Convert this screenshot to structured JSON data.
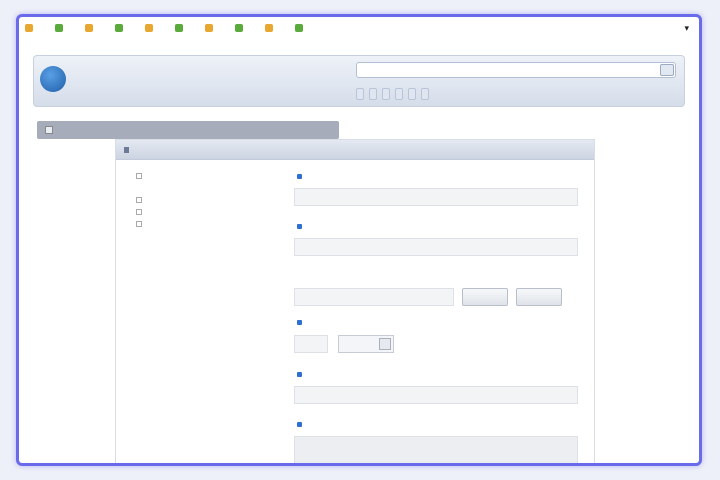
{
  "bookmarks": [
    {
      "label": "",
      "favicon": "orange-favicon-icon"
    },
    {
      "label": "",
      "favicon": "green-favicon-icon"
    },
    {
      "label": "",
      "favicon": "orange-favicon-icon"
    },
    {
      "label": "",
      "favicon": "green-favicon-icon"
    },
    {
      "label": "",
      "favicon": "orange-favicon-icon"
    },
    {
      "label": "",
      "favicon": "green-favicon-icon"
    },
    {
      "label": "",
      "favicon": "orange-favicon-icon"
    },
    {
      "label": "",
      "favicon": "green-favicon-icon"
    },
    {
      "label": "",
      "favicon": "orange-favicon-icon"
    },
    {
      "label": "",
      "favicon": "green-favicon-icon"
    }
  ],
  "all_events_label": "",
  "header": {
    "logo_letter": "",
    "user_name": "",
    "user_subtitle": "",
    "search_value": "",
    "nav": [
      "",
      "",
      "",
      "",
      "",
      ""
    ]
  },
  "page_heading": "",
  "panel": {
    "title": "",
    "tree": [
      {
        "label": "",
        "level": 1
      },
      {
        "label": "",
        "level": 0
      },
      {
        "label": "",
        "level": 1
      },
      {
        "label": "",
        "level": 1
      },
      {
        "label": "",
        "level": 1
      }
    ],
    "fields": {
      "name_label": "",
      "keywords_label": "",
      "file_label": "",
      "browse_label": "",
      "upload_label": "",
      "age_label": "",
      "age_unit": "",
      "specialization_label": "",
      "description_label": ""
    }
  },
  "colors": {
    "frame_border": "#6a6bea",
    "header_text": "#2d4f86",
    "required_marker": "#2f6fd0"
  }
}
